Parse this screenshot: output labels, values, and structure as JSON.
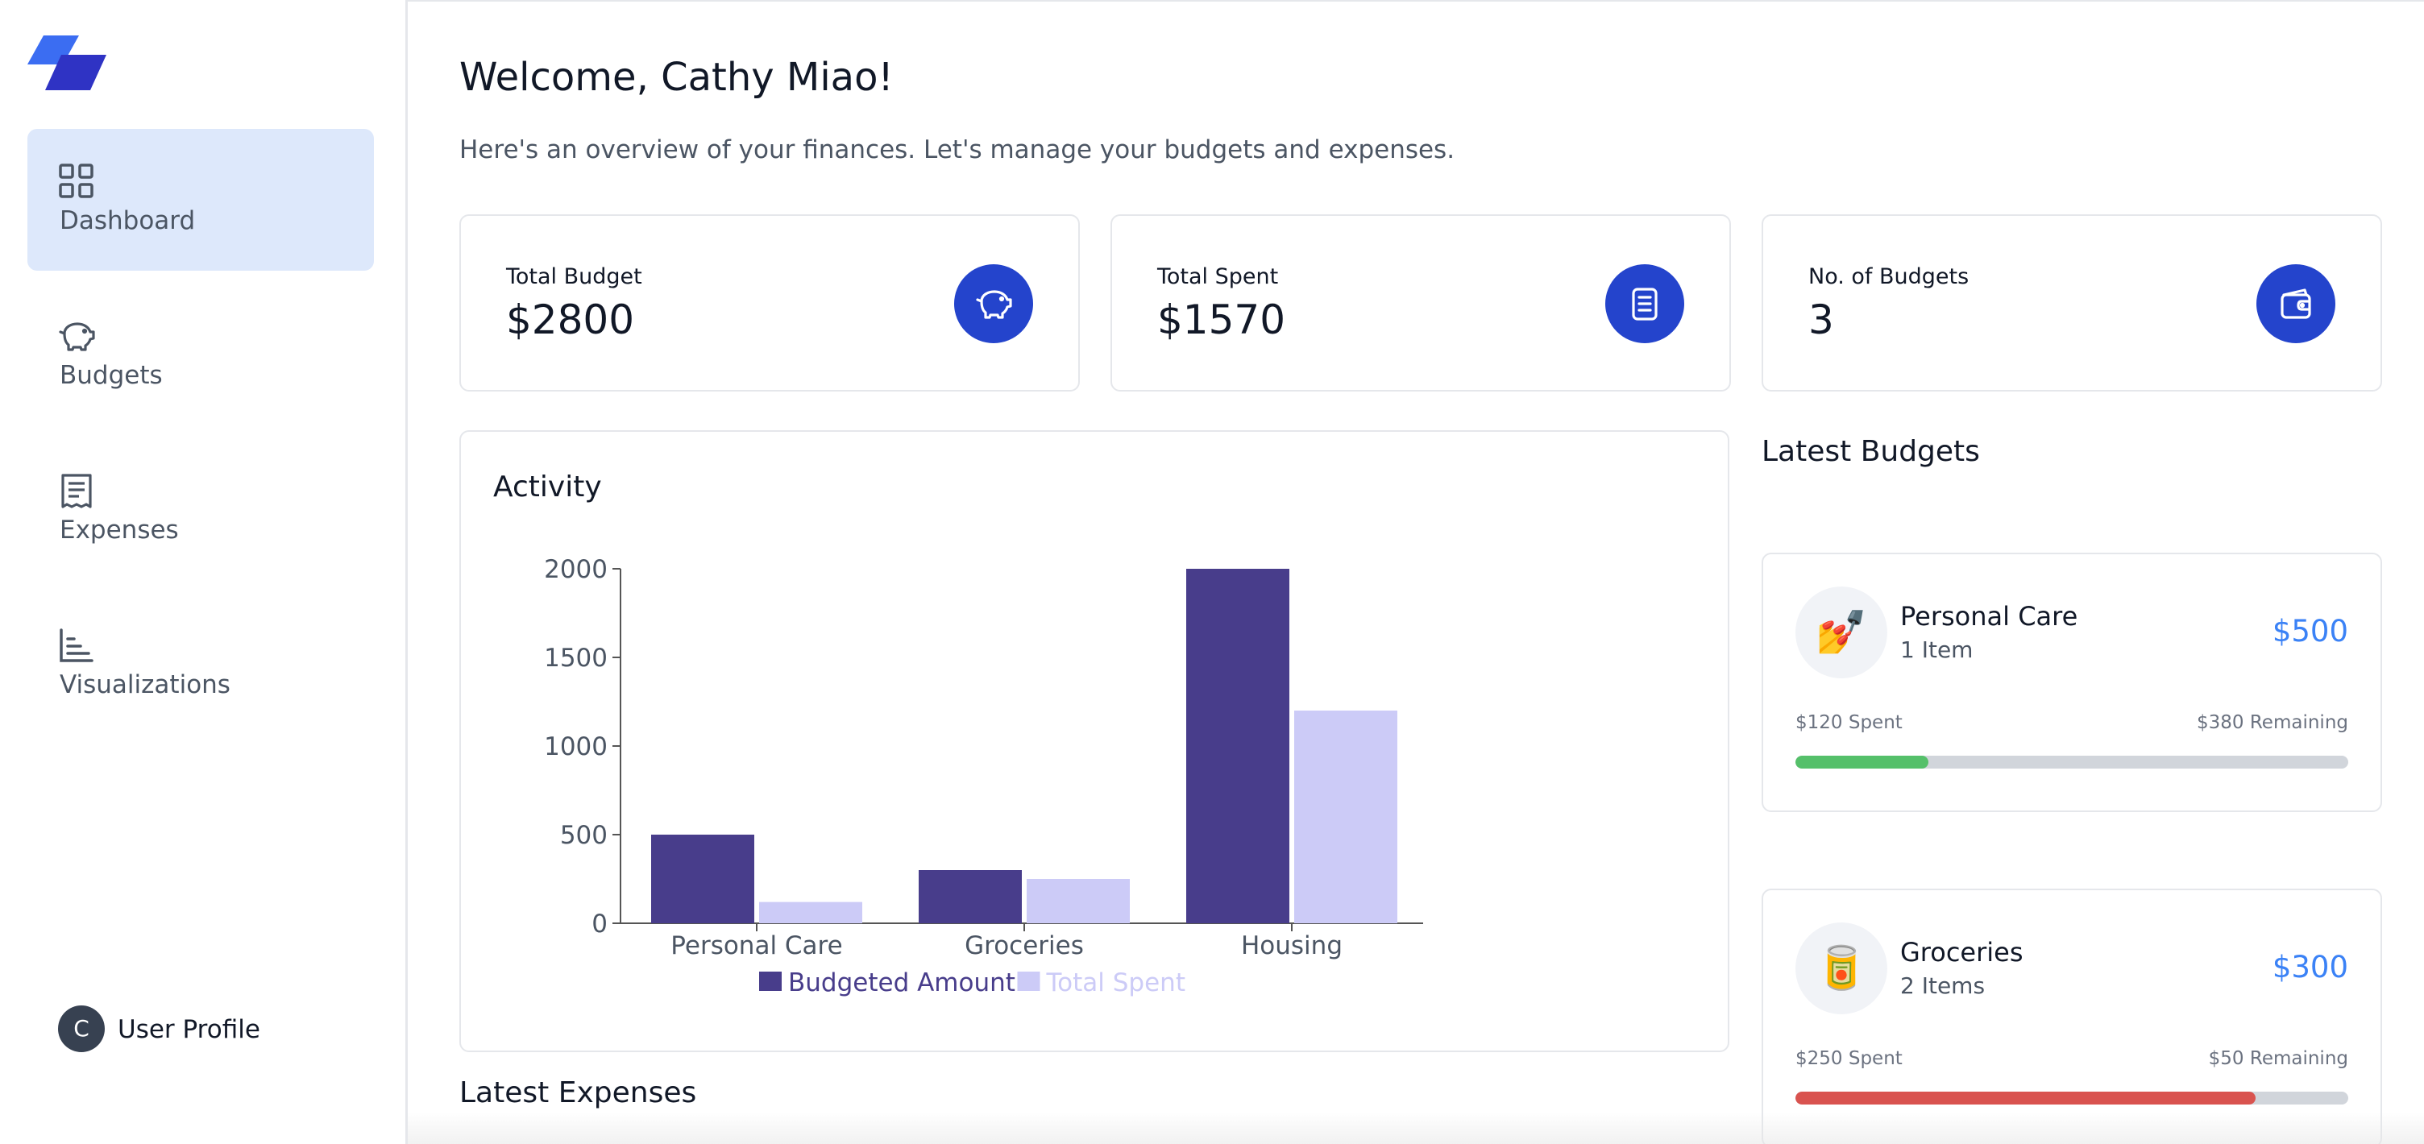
{
  "app": {
    "logo_icon": "stacked-parallelogram-logo",
    "accent_color": "#2444cc"
  },
  "sidebar": {
    "items": [
      {
        "label": "Dashboard",
        "icon": "grid-icon",
        "active": true
      },
      {
        "label": "Budgets",
        "icon": "piggy-bank-icon",
        "active": false
      },
      {
        "label": "Expenses",
        "icon": "receipt-icon",
        "active": false
      },
      {
        "label": "Visualizations",
        "icon": "bar-chart-icon",
        "active": false
      }
    ],
    "profile": {
      "initial": "C",
      "label": "User Profile"
    }
  },
  "header": {
    "welcome": "Welcome, Cathy Miao!",
    "subtitle": "Here's an overview of your finances. Let's manage your budgets and expenses."
  },
  "stats": [
    {
      "label": "Total Budget",
      "value": "$2800",
      "icon": "piggy-bank-icon"
    },
    {
      "label": "Total Spent",
      "value": "$1570",
      "icon": "receipt-icon"
    },
    {
      "label": "No. of Budgets",
      "value": "3",
      "icon": "wallet-icon"
    }
  ],
  "activity": {
    "title": "Activity"
  },
  "chart_data": {
    "type": "bar",
    "categories": [
      "Personal Care",
      "Groceries",
      "Housing"
    ],
    "series": [
      {
        "name": "Budgeted Amount",
        "values": [
          500,
          300,
          2000
        ],
        "color": "#483d8b"
      },
      {
        "name": "Total Spent",
        "values": [
          120,
          250,
          1200
        ],
        "color": "#cccbf7"
      }
    ],
    "yticks": [
      "0",
      "500",
      "1000",
      "1500",
      "2000"
    ],
    "ylim": [
      0,
      2000
    ],
    "legend": "bottom"
  },
  "latest_expenses": {
    "title": "Latest Expenses"
  },
  "latest_budgets": {
    "title": "Latest Budgets",
    "items": [
      {
        "emoji": "💅",
        "name": "Personal Care",
        "items": "1 Item",
        "amount": "$500",
        "spent": "$120 Spent",
        "remaining": "$380 Remaining",
        "progress": 0.24,
        "bar_color": "#55c06a"
      },
      {
        "emoji": "🥫",
        "name": "Groceries",
        "items": "2 Items",
        "amount": "$300",
        "spent": "$250 Spent",
        "remaining": "$50 Remaining",
        "progress": 0.833,
        "bar_color": "#d9534f"
      }
    ]
  }
}
